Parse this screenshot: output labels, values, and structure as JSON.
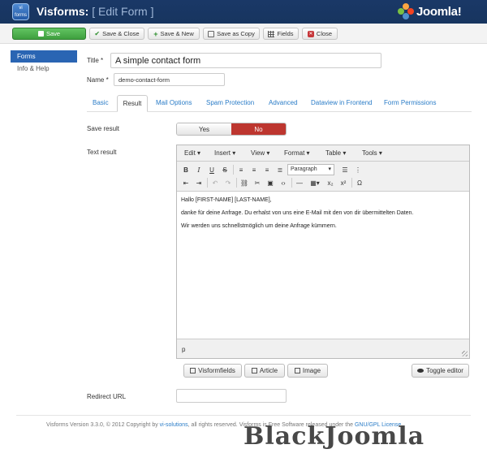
{
  "header": {
    "logo_text": "vi forms",
    "app_name": "Visforms:",
    "page_name": "[ Edit Form ]",
    "brand": "Joomla!"
  },
  "toolbar": {
    "save": "Save",
    "save_close": "Save & Close",
    "save_new": "Save & New",
    "save_copy": "Save as Copy",
    "fields": "Fields",
    "close": "Close"
  },
  "sidebar": {
    "items": [
      {
        "label": "Forms",
        "active": true
      },
      {
        "label": "Info & Help",
        "active": false
      }
    ]
  },
  "form": {
    "title_label": "Title *",
    "title_value": "A simple contact form",
    "name_label": "Name *",
    "name_value": "demo-contact-form",
    "save_result_label": "Save result",
    "yes_label": "Yes",
    "no_label": "No",
    "save_result_selected": "No",
    "text_result_label": "Text result",
    "redirect_label": "Redirect URL",
    "redirect_value": ""
  },
  "tabs": [
    {
      "label": "Basic",
      "active": false
    },
    {
      "label": "Result",
      "active": true
    },
    {
      "label": "Mail Options",
      "active": false
    },
    {
      "label": "Spam Protection",
      "active": false
    },
    {
      "label": "Advanced",
      "active": false
    },
    {
      "label": "Dataview in Frontend",
      "active": false
    },
    {
      "label": "Form Permissions",
      "active": false
    }
  ],
  "editor": {
    "menus": [
      "Edit ▾",
      "Insert ▾",
      "View ▾",
      "Format ▾",
      "Table ▾",
      "Tools ▾"
    ],
    "format_select": "Paragraph",
    "content": [
      "Hallo [FIRST-NAME] [LAST-NAME],",
      "danke für deine Anfrage. Du erhalst von uns eine E-Mail mit den von dir übermittelten Daten.",
      "Wir werden uns schnellstmöglich um deine Anfrage kümmern."
    ],
    "path": "p"
  },
  "editor_buttons": {
    "visformfields": "Visformfields",
    "article": "Article",
    "image": "Image",
    "toggle_editor": "Toggle editor"
  },
  "footer": {
    "prefix": "Visforms Version 3.3.0, © 2012 Copyright by ",
    "link": "vi-solutions",
    "middle": ", all rights reserved. Visforms is Free Software released under the ",
    "license": "GNU/GPL License"
  },
  "watermark": "BlackJoomla",
  "colors": {
    "header_bg": "#1a3867",
    "accent": "#2a65b3",
    "save_green": "#51a351",
    "no_red": "#bd362f"
  }
}
